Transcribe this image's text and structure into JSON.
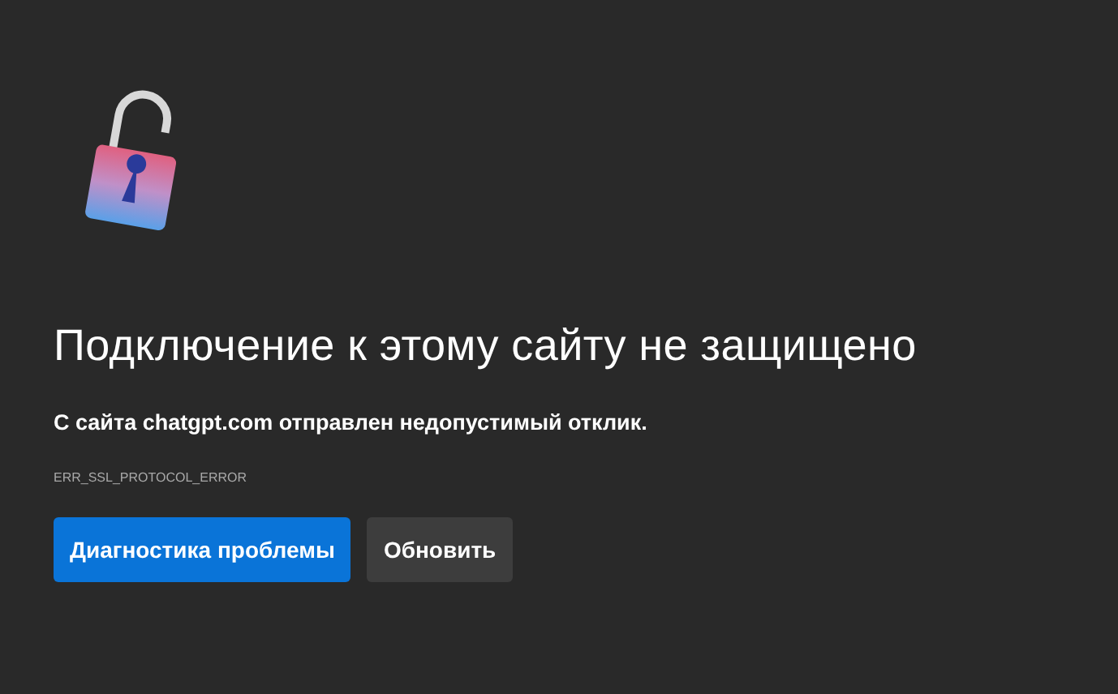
{
  "heading": "Подключение к этому сайту не защищено",
  "message": "С сайта **chatgpt.com** отправлен недопустимый отклик.",
  "error_code": "ERR_SSL_PROTOCOL_ERROR",
  "buttons": [
    {
      "label": "Диагностика проблемы",
      "kind": "primary"
    },
    {
      "label": "Обновить",
      "kind": "secondary"
    }
  ]
}
